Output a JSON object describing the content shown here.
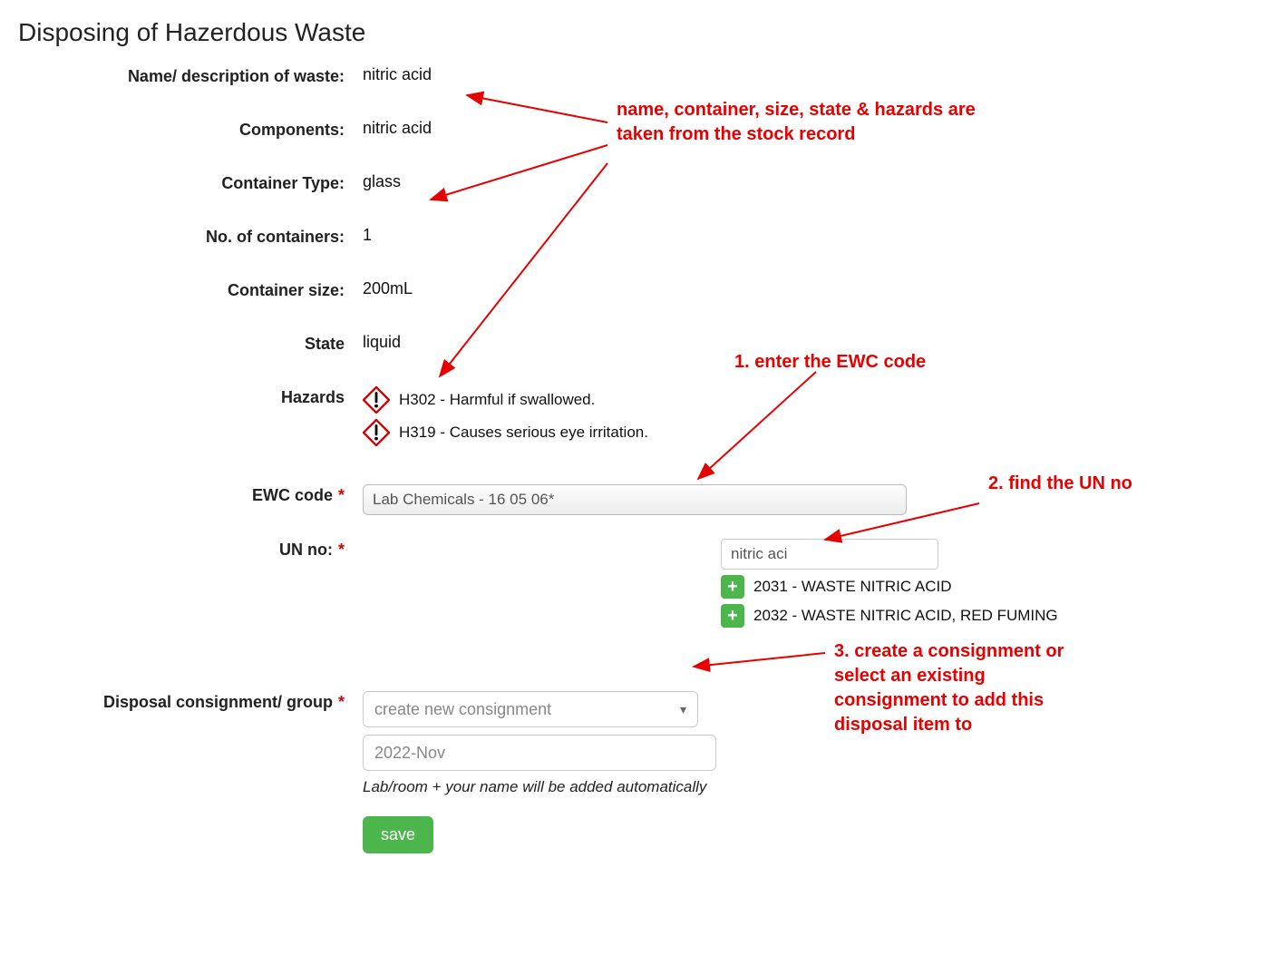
{
  "title": "Disposing of Hazerdous Waste",
  "labels": {
    "name": "Name/ description of waste:",
    "components": "Components:",
    "container_type": "Container Type:",
    "num_containers": "No. of containers:",
    "container_size": "Container size:",
    "state": "State",
    "hazards": "Hazards",
    "ewc": "EWC code",
    "un": "UN no:",
    "disposal": "Disposal consignment/ group"
  },
  "values": {
    "name": "nitric acid",
    "components": "nitric acid",
    "container_type": "glass",
    "num_containers": "1",
    "container_size": "200mL",
    "state": "liquid"
  },
  "hazards": [
    "H302 - Harmful if swallowed.",
    "H319 - Causes serious eye irritation."
  ],
  "ewc_value": "Lab Chemicals - 16 05 06*",
  "un_search": "nitric aci",
  "un_results": [
    "2031 - WASTE NITRIC ACID",
    "2032 - WASTE NITRIC ACID, RED FUMING"
  ],
  "consignment_placeholder": "create new consignment",
  "consignment_date": "2022-Nov",
  "helper_text": "Lab/room + your name will be added automatically",
  "save_label": "save",
  "annotations": {
    "stock": "name, container, size, state & hazards are taken from the stock record",
    "step1": "1. enter the EWC code",
    "step2": "2. find the UN no",
    "step3": "3. create a consignment or select an existing consignment to add this disposal item to"
  },
  "colors": {
    "accent_red": "#e60000",
    "accent_green": "#4cb64c"
  }
}
